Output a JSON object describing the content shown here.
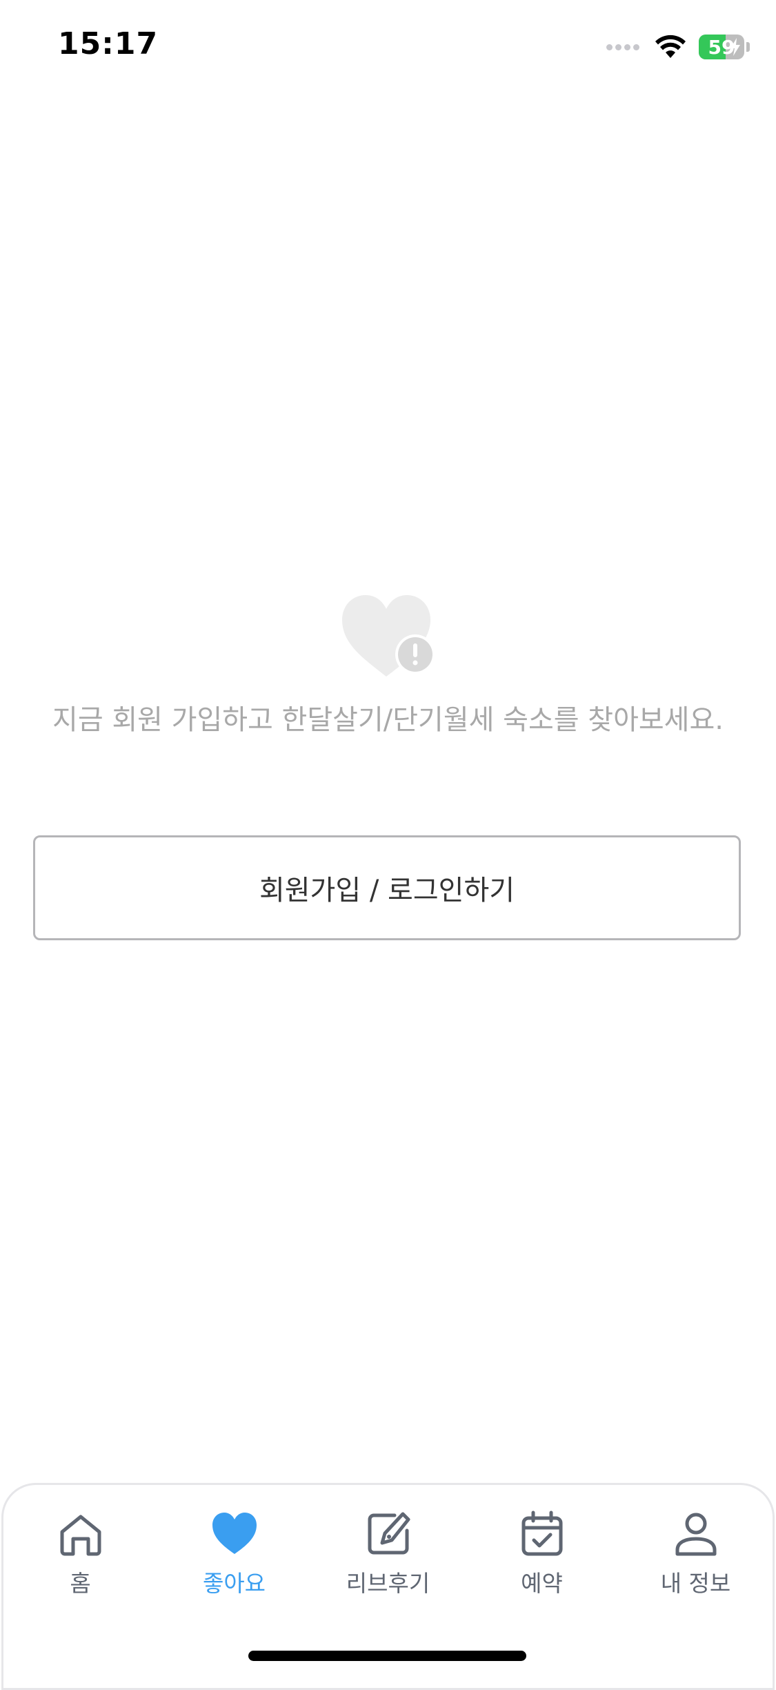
{
  "status_bar": {
    "time": "15:17",
    "battery_level": 59,
    "battery_text": "59",
    "battery_color": "#34c759"
  },
  "empty_state": {
    "icon": "heart-exclamation-icon",
    "message": "지금 회원 가입하고 한달살기/단기월세 숙소를 찾아보세요.",
    "button_label": "회원가입 / 로그인하기"
  },
  "tab_bar": {
    "active_color": "#3a9ef0",
    "inactive_color": "#5f6672",
    "items": [
      {
        "label": "홈",
        "icon": "home-icon",
        "active": false
      },
      {
        "label": "좋아요",
        "icon": "heart-icon",
        "active": true
      },
      {
        "label": "리브후기",
        "icon": "review-pen-icon",
        "active": false
      },
      {
        "label": "예약",
        "icon": "calendar-check-icon",
        "active": false
      },
      {
        "label": "내 정보",
        "icon": "user-icon",
        "active": false
      }
    ]
  }
}
